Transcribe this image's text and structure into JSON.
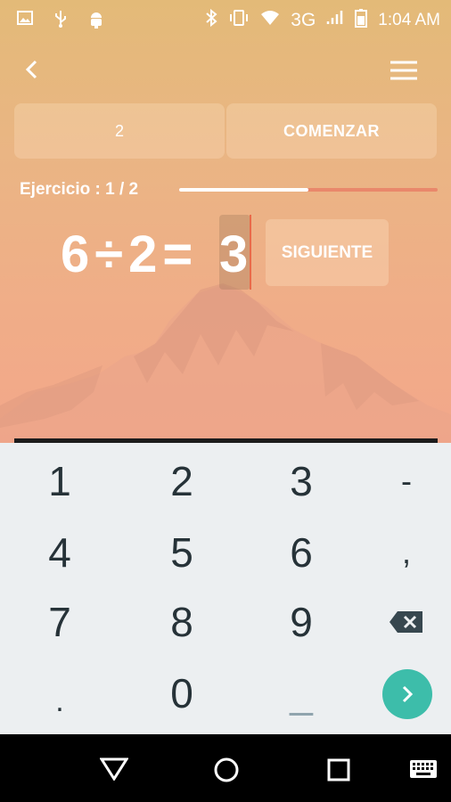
{
  "status_bar": {
    "network": "3G",
    "time": "1:04 AM",
    "icons": [
      "image-icon",
      "usb-icon",
      "android-icon",
      "bluetooth-icon",
      "vibrate-icon",
      "wifi-icon",
      "signal-icon",
      "battery-icon"
    ]
  },
  "header": {
    "back_icon": "back-arrow-icon",
    "menu_icon": "hamburger-menu-icon"
  },
  "controls": {
    "count_value": "2",
    "start_label": "COMENZAR"
  },
  "exercise": {
    "label": "Ejercicio : 1 / 2",
    "progress": 0.5
  },
  "equation": {
    "left": "6",
    "operator": "÷",
    "right": "2",
    "equals": "=",
    "answer": "3",
    "next_label": "SIGUIENTE"
  },
  "keyboard": {
    "keys": [
      "1",
      "2",
      "3",
      "-",
      "4",
      "5",
      "6",
      ",",
      "7",
      "8",
      "9",
      ".",
      "0",
      "_"
    ],
    "backspace_icon": "backspace-icon",
    "go_icon": "chevron-right-icon",
    "accent_color": "#3dbdaa"
  },
  "nav_bar": {
    "icons": [
      "back-triangle-icon",
      "home-circle-icon",
      "recents-square-icon",
      "keyboard-icon"
    ]
  }
}
